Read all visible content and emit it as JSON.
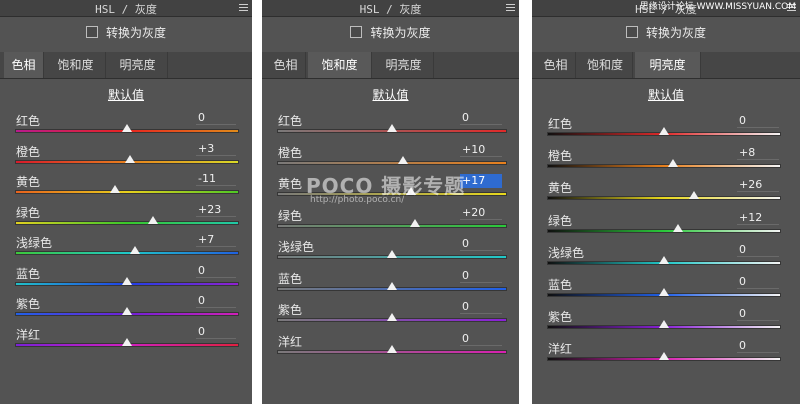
{
  "panels": [
    {
      "title": "HSL / 灰度",
      "convert_to_gray_label": "转换为灰度",
      "tabs": [
        "色相",
        "饱和度",
        "明亮度"
      ],
      "active_tab": 0,
      "defaults_label": "默认值",
      "rows": [
        {
          "label": "红色",
          "value": "0",
          "level": 0.5,
          "gradient": "linear-gradient(90deg,#b81a8c,#e8241f,#e08a1a)"
        },
        {
          "label": "橙色",
          "value": "+3",
          "level": 0.515,
          "gradient": "linear-gradient(90deg,#d81a2a,#e8801d,#d8d827)"
        },
        {
          "label": "黄色",
          "value": "-11",
          "level": 0.445,
          "gradient": "linear-gradient(90deg,#e8621d,#e8d01d,#4fc825)"
        },
        {
          "label": "绿色",
          "value": "+23",
          "level": 0.615,
          "gradient": "linear-gradient(90deg,#e0d020,#39c82a,#20c8a8)"
        },
        {
          "label": "浅绿色",
          "value": "+7",
          "level": 0.535,
          "gradient": "linear-gradient(90deg,#3cc83a,#1fc8c8,#2060e0)"
        },
        {
          "label": "蓝色",
          "value": "0",
          "level": 0.5,
          "gradient": "linear-gradient(90deg,#20c0c8,#2040e8,#9020d0)"
        },
        {
          "label": "紫色",
          "value": "0",
          "level": 0.5,
          "gradient": "linear-gradient(90deg,#2060e8,#7020d8,#d020b8)"
        },
        {
          "label": "洋红",
          "value": "0",
          "level": 0.5,
          "gradient": "linear-gradient(90deg,#7a20d8,#d020c0,#e02040)"
        }
      ]
    },
    {
      "title": "HSL / 灰度",
      "convert_to_gray_label": "转换为灰度",
      "tabs": [
        "色相",
        "饱和度",
        "明亮度"
      ],
      "active_tab": 1,
      "defaults_label": "默认值",
      "rows": [
        {
          "label": "红色",
          "value": "0",
          "level": 0.5,
          "gradient": "linear-gradient(90deg,#7a7a7a,#e02a2a)"
        },
        {
          "label": "橙色",
          "value": "+10",
          "level": 0.55,
          "gradient": "linear-gradient(90deg,#7a7a7a,#e8801d)"
        },
        {
          "label": "黄色",
          "value": "+17",
          "level": 0.585,
          "gradient": "linear-gradient(90deg,#7a7a7a,#e8d81d)"
        },
        {
          "label": "绿色",
          "value": "+20",
          "level": 0.6,
          "gradient": "linear-gradient(90deg,#7a7a7a,#2ac83a)"
        },
        {
          "label": "浅绿色",
          "value": "0",
          "level": 0.5,
          "gradient": "linear-gradient(90deg,#7a7a7a,#20c8c8)"
        },
        {
          "label": "蓝色",
          "value": "0",
          "level": 0.5,
          "gradient": "linear-gradient(90deg,#7a7a7a,#2060e8)"
        },
        {
          "label": "紫色",
          "value": "0",
          "level": 0.5,
          "gradient": "linear-gradient(90deg,#7a7a7a,#8a20d8)"
        },
        {
          "label": "洋红",
          "value": "0",
          "level": 0.5,
          "gradient": "linear-gradient(90deg,#7a7a7a,#d820b0)"
        }
      ]
    },
    {
      "title": "HSL / 灰度",
      "convert_to_gray_label": "转换为灰度",
      "tabs": [
        "色相",
        "饱和度",
        "明亮度"
      ],
      "active_tab": 2,
      "defaults_label": "默认值",
      "rows": [
        {
          "label": "红色",
          "value": "0",
          "level": 0.5,
          "gradient": "linear-gradient(90deg,#101010,#e02a2a,#f4f4f4)"
        },
        {
          "label": "橙色",
          "value": "+8",
          "level": 0.54,
          "gradient": "linear-gradient(90deg,#101010,#e8801d,#f4f4f4)"
        },
        {
          "label": "黄色",
          "value": "+26",
          "level": 0.63,
          "gradient": "linear-gradient(90deg,#101010,#e8d81d,#f4f4f4)"
        },
        {
          "label": "绿色",
          "value": "+12",
          "level": 0.56,
          "gradient": "linear-gradient(90deg,#101010,#2ac83a,#f4f4f4)"
        },
        {
          "label": "浅绿色",
          "value": "0",
          "level": 0.5,
          "gradient": "linear-gradient(90deg,#101010,#20c8c8,#f4f4f4)"
        },
        {
          "label": "蓝色",
          "value": "0",
          "level": 0.5,
          "gradient": "linear-gradient(90deg,#101010,#2060e8,#f4f4f4)"
        },
        {
          "label": "紫色",
          "value": "0",
          "level": 0.5,
          "gradient": "linear-gradient(90deg,#101010,#8a20d8,#f4f4f4)"
        },
        {
          "label": "洋红",
          "value": "0",
          "level": 0.5,
          "gradient": "linear-gradient(90deg,#101010,#d820b0,#f4f4f4)"
        }
      ]
    }
  ],
  "highlighted_value": {
    "panel": 1,
    "row": 2
  },
  "watermark": {
    "brand": "POCO 摄影专题",
    "url": "http://photo.poco.cn/"
  },
  "corner_watermark": "思缘设计论坛 WWW.MISSYUAN.COM"
}
